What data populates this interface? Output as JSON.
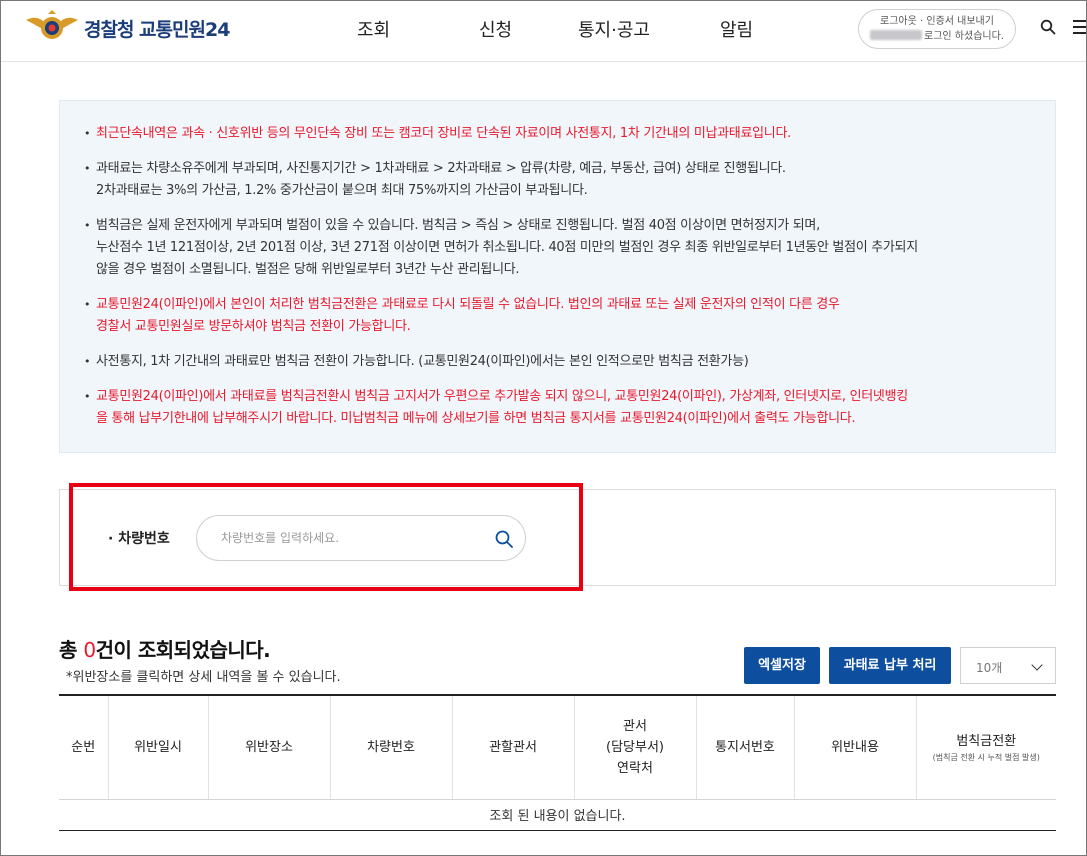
{
  "header": {
    "logo_text": "경찰청 교통민원24",
    "nav": [
      "조회",
      "신청",
      "통지·공고",
      "알림"
    ],
    "login_links": "로그아웃 · 인증서 내보내기",
    "login_status": "로그인 하셨습니다."
  },
  "notice": {
    "items": [
      {
        "lines": [
          "최근단속내역은 과속 · 신호위반 등의 무인단속 장비 또는 캠코더 장비로 단속된 자료이며 사전통지, 1차 기간내의 미납과태료입니다."
        ],
        "red": true
      },
      {
        "lines": [
          "과태료는 차량소유주에게 부과되며, 사진통지기간 > 1차과태료 > 2차과태료 > 압류(차량, 예금, 부동산, 급여) 상태로 진행됩니다.",
          "2차과태료는 3%의 가산금, 1.2% 중가산금이 붙으며 최대 75%까지의 가산금이 부과됩니다."
        ],
        "red": false
      },
      {
        "lines": [
          "범칙금은 실제 운전자에게 부과되며 벌점이 있을 수 있습니다. 범칙금 > 즉심 > 상태로 진행됩니다. 벌점 40점 이상이면 면허정지가 되며,",
          "누산점수 1년 121점이상, 2년 201점 이상, 3년 271점 이상이면 면허가 취소됩니다. 40점 미만의 벌점인 경우 최종 위반일로부터 1년동안 벌점이 추가되지",
          "않을 경우 벌점이 소멸됩니다. 벌점은 당해 위반일로부터 3년간 누산 관리됩니다."
        ],
        "red": false
      },
      {
        "lines": [
          "교통민원24(이파인)에서 본인이 처리한 범칙금전환은 과태료로 다시 되돌릴 수 없습니다. 법인의 과태료 또는 실제 운전자의 인적이 다른 경우",
          "경찰서 교통민원실로 방문하셔야 범칙금 전환이 가능합니다."
        ],
        "red": true
      },
      {
        "lines": [
          "사전통지, 1차 기간내의 과태료만 범칙금 전환이 가능합니다. (교통민원24(이파인)에서는 본인 인적으로만 범칙금 전환가능)"
        ],
        "red": false
      },
      {
        "lines": [
          "교통민원24(이파인)에서 과태료를 범칙금전환시 범칙금 고지서가 우편으로 추가발송 되지 않으니, 교통민원24(이파인), 가상계좌, 인터넷지로, 인터넷뱅킹",
          "을 통해 납부기한내에 납부해주시기 바랍니다. 미납범칙금 메뉴에 상세보기를 하면 범칙금 통지서를 교통민원24(이파인)에서 출력도 가능합니다."
        ],
        "red": true
      }
    ]
  },
  "search": {
    "label": "· 차량번호",
    "placeholder": "차량번호를 입력하세요.",
    "value": ""
  },
  "results": {
    "prefix": "총 ",
    "count": "0",
    "suffix": "건이 조회되었습니다.",
    "hint": "*위반장소를 클릭하면 상세 내역을 볼 수 있습니다.",
    "excel_button": "엑셀저장",
    "pay_button": "과태료 납부 처리",
    "page_size": "10개"
  },
  "table": {
    "columns": [
      "순번",
      "위반일시",
      "위반장소",
      "차량번호",
      "관할관서",
      "관서\n(담당부서)\n연락처",
      "통지서번호",
      "위반내용"
    ],
    "last_column": "범칙금전환",
    "last_column_sub": "(범칙금 전환 시 누적 벌점 발생)",
    "empty_message": "조회 된 내용이 없습니다."
  },
  "colors": {
    "brand": "#1b3d7a",
    "button": "#0d4f9e",
    "alert_red": "#e8192c",
    "highlight": "#e60012"
  }
}
